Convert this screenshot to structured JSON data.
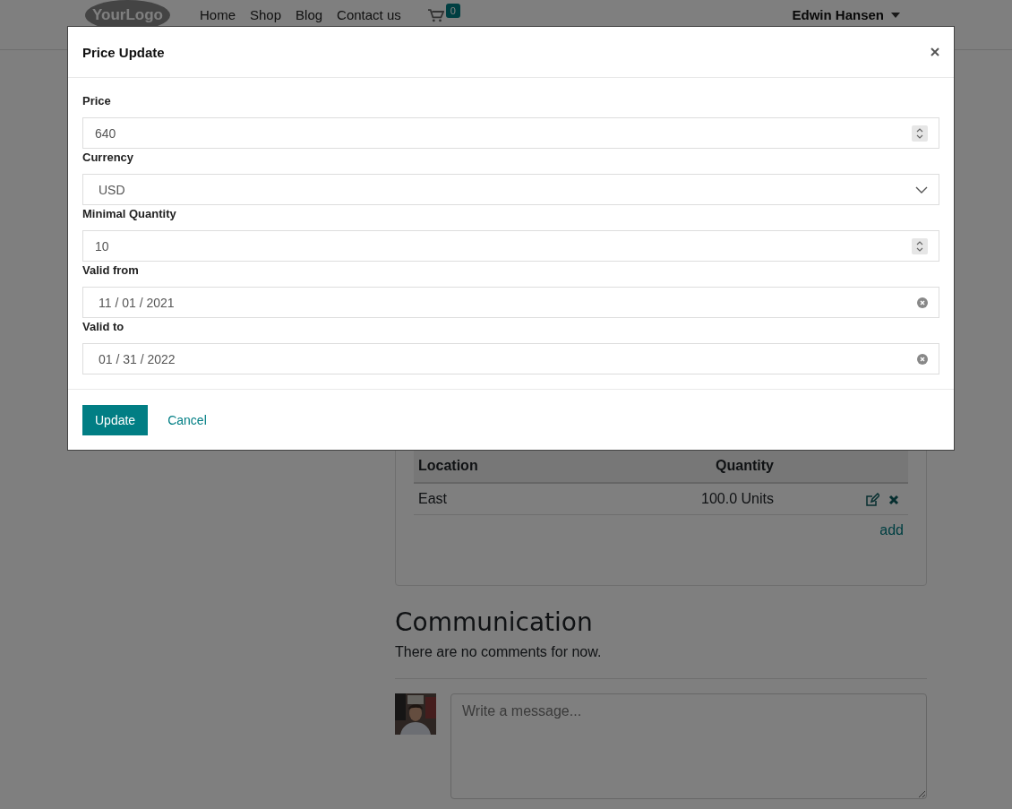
{
  "navbar": {
    "logo": "YourLogo",
    "links": [
      "Home",
      "Shop",
      "Blog",
      "Contact us"
    ],
    "cart_count": "0",
    "user": "Edwin Hansen"
  },
  "stock_table": {
    "columns": [
      "Location",
      "Quantity"
    ],
    "rows": [
      {
        "location": "East",
        "quantity": "100.0 Units"
      }
    ],
    "add_link": "add"
  },
  "communication": {
    "heading": "Communication",
    "empty_text": "There are no comments for now.",
    "message_placeholder": "Write a message..."
  },
  "dialog": {
    "title": "Price Update",
    "fields": [
      {
        "label": "Price",
        "kind": "number",
        "value": "640"
      },
      {
        "label": "Currency",
        "kind": "select",
        "value": "USD"
      },
      {
        "label": "Minimal Quantity",
        "kind": "number",
        "value": "10"
      },
      {
        "label": "Valid from",
        "kind": "date",
        "value": "11 / 01 / 2021"
      },
      {
        "label": "Valid to",
        "kind": "date",
        "value": "01 / 31 / 2022"
      }
    ],
    "primary_button": "Update",
    "cancel_link": "Cancel"
  }
}
